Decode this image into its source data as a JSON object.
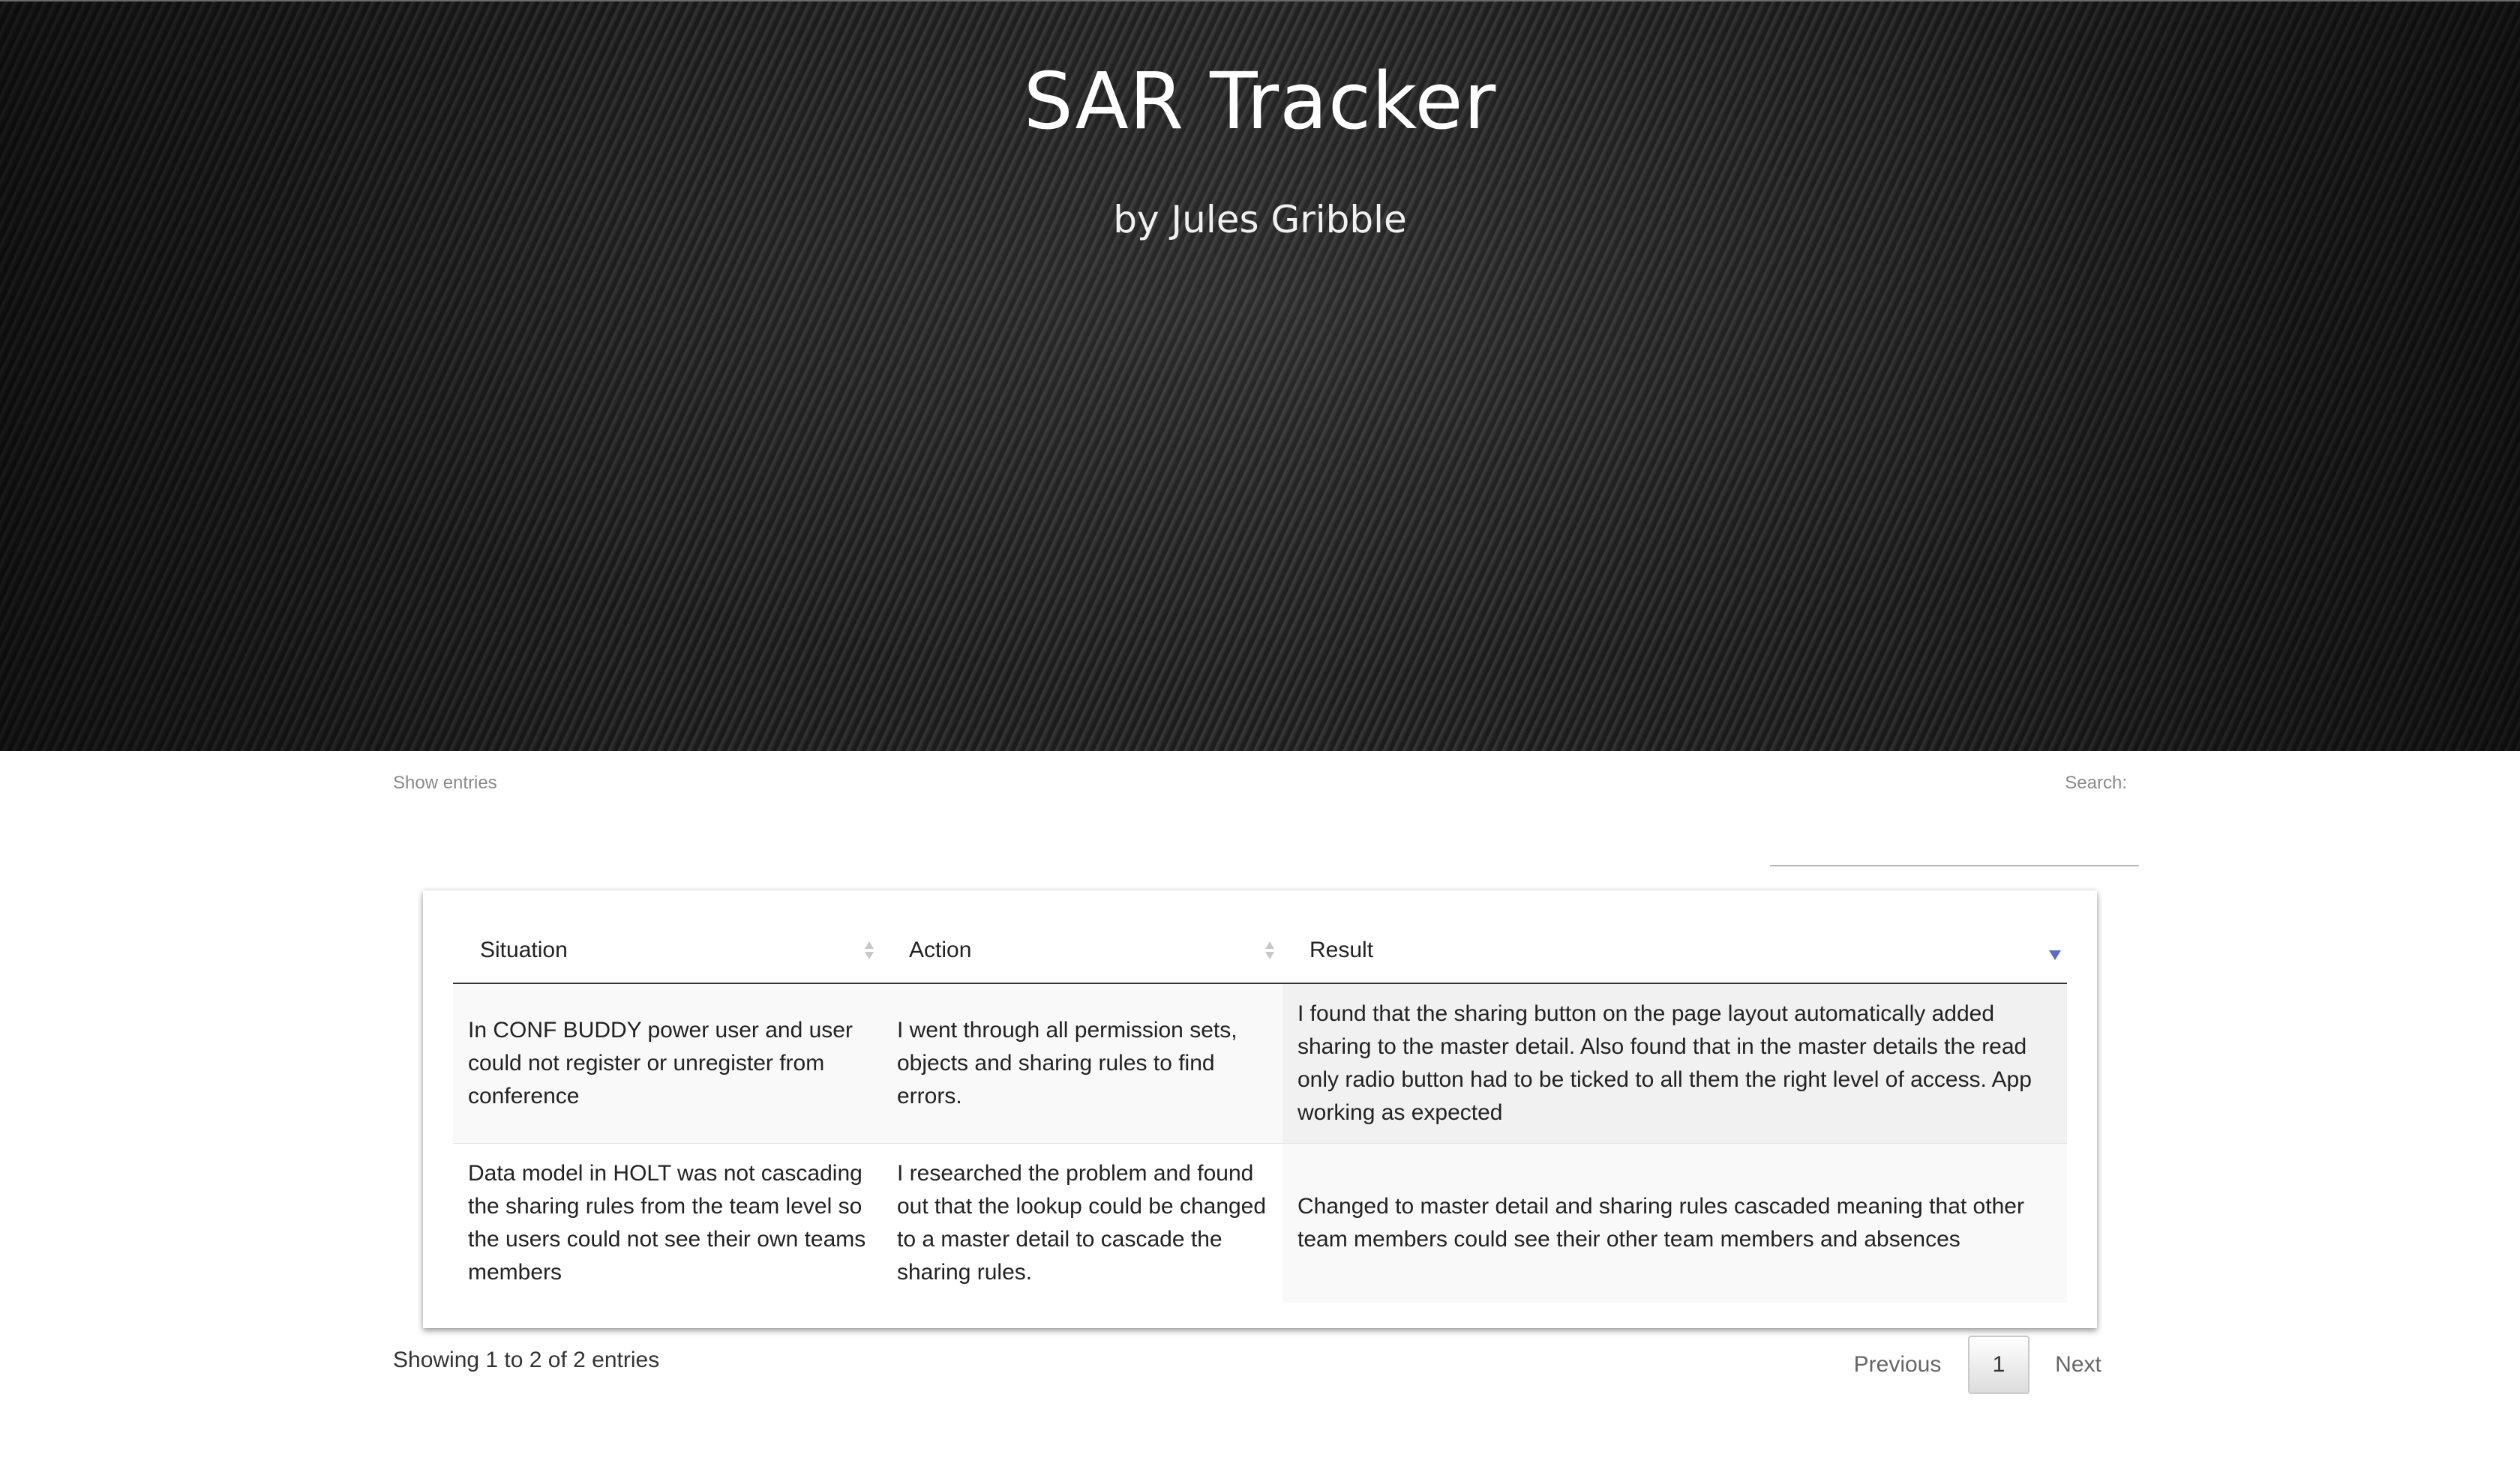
{
  "hero": {
    "title": "SAR Tracker",
    "subtitle": "by Jules Gribble"
  },
  "controls": {
    "length_label": "Show entries",
    "search_label": "Search:",
    "search_value": ""
  },
  "table": {
    "columns": [
      {
        "label": "Situation",
        "sort": "both"
      },
      {
        "label": "Action",
        "sort": "both"
      },
      {
        "label": "Result",
        "sort": "desc"
      }
    ],
    "rows": [
      {
        "situation": "In CONF BUDDY power user and user could not register or unregister from conference",
        "action": "I went through all permission sets, objects and sharing rules to find errors.",
        "result": "I found that the sharing button on the page layout automatically added sharing to the master detail. Also found that in the master details the read only radio button had to be ticked to all them the right level of access. App working as expected"
      },
      {
        "situation": "Data model in HOLT was not cascading the sharing rules from the team level so the users could not see their own teams members",
        "action": "I researched the problem and found out that the lookup could be changed to a master detail to cascade the sharing rules.",
        "result": "Changed to master detail and sharing rules cascaded meaning that other team members could see their other team members and absences"
      }
    ]
  },
  "footer": {
    "info": "Showing 1 to 2 of 2 entries",
    "previous_label": "Previous",
    "current_page": "1",
    "next_label": "Next"
  },
  "colors": {
    "sort_active": "#5c6bc0",
    "header_rule": "#333333"
  }
}
